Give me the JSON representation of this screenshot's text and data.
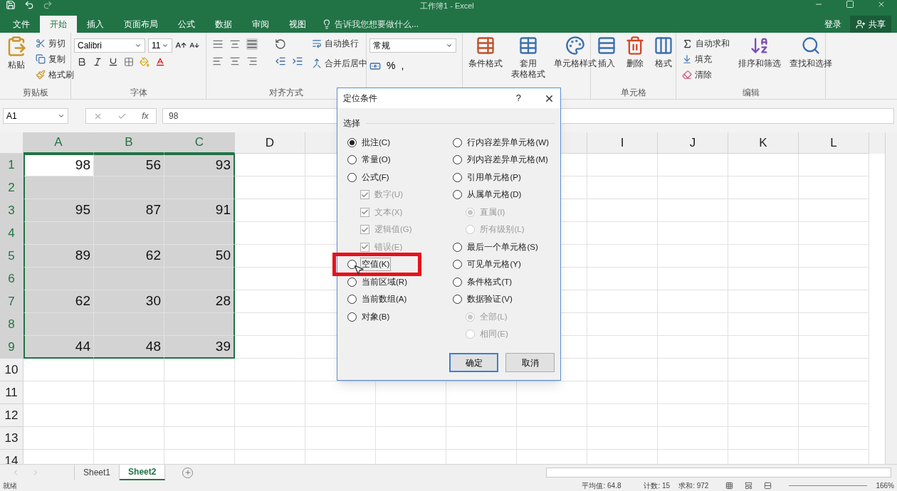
{
  "title_bar": {
    "title": "工作簿1 - Excel"
  },
  "tabs": [
    {
      "label": "文件",
      "selected": false
    },
    {
      "label": "开始",
      "selected": true
    },
    {
      "label": "插入",
      "selected": false
    },
    {
      "label": "页面布局",
      "selected": false
    },
    {
      "label": "公式",
      "selected": false
    },
    {
      "label": "数据",
      "selected": false
    },
    {
      "label": "审阅",
      "selected": false
    },
    {
      "label": "视图",
      "selected": false
    }
  ],
  "tell_me": {
    "placeholder": "告诉我您想要做什么..."
  },
  "account": {
    "sign_in": "登录",
    "share": "共享"
  },
  "ribbon": {
    "groups": [
      {
        "kind": "clipboard",
        "label": "剪贴板",
        "items": [
          "粘贴",
          "剪切",
          "复制",
          "格式刷"
        ]
      },
      {
        "kind": "font",
        "label": "字体",
        "font": "Calibri",
        "size": "11"
      },
      {
        "kind": "alignment",
        "label": "对齐方式",
        "items": [
          "自动换行",
          "合并后居中"
        ]
      },
      {
        "kind": "number",
        "format": "常规",
        "symbols": [
          "%",
          ","
        ]
      },
      {
        "kind": "styles",
        "items": [
          "条件格式",
          [
            "套用",
            "表格格式"
          ],
          "单元格样式"
        ]
      },
      {
        "kind": "cells",
        "label": "单元格",
        "items": [
          "插入",
          "删除",
          "格式"
        ]
      },
      {
        "kind": "editing",
        "label": "编辑",
        "items": [
          "自动求和",
          "填充",
          "清除",
          "排序和筛选",
          "查找和选择"
        ]
      }
    ]
  },
  "formula_bar": {
    "name_box": "A1",
    "function_label": "fx",
    "value": "98"
  },
  "sheet": {
    "columns_left": [
      "A",
      "B",
      "C",
      "D"
    ],
    "columns_right": [
      "I",
      "J",
      "K",
      "L"
    ],
    "rows": [
      {
        "label": "1",
        "cells": [
          {
            "value": "98",
            "in_range": true,
            "active": true
          },
          {
            "value": "56",
            "in_range": true,
            "active": false
          },
          {
            "value": "93",
            "in_range": true,
            "active": false
          }
        ]
      },
      {
        "label": "2",
        "cells": [
          {
            "in_range": true,
            "active": false
          },
          {
            "in_range": true,
            "active": false
          },
          {
            "in_range": true,
            "active": false
          }
        ]
      },
      {
        "label": "3",
        "cells": [
          {
            "value": "95",
            "in_range": true,
            "active": false
          },
          {
            "value": "87",
            "in_range": true,
            "active": false
          },
          {
            "value": "91",
            "in_range": true,
            "active": false
          }
        ]
      },
      {
        "label": "4",
        "cells": [
          {
            "in_range": true,
            "active": false
          },
          {
            "in_range": true,
            "active": false
          },
          {
            "in_range": true,
            "active": false
          }
        ]
      },
      {
        "label": "5",
        "cells": [
          {
            "value": "89",
            "in_range": true,
            "active": false
          },
          {
            "value": "62",
            "in_range": true,
            "active": false
          },
          {
            "value": "50",
            "in_range": true,
            "active": false
          }
        ]
      },
      {
        "label": "6",
        "cells": [
          {
            "in_range": true,
            "active": false
          },
          {
            "in_range": true,
            "active": false
          },
          {
            "in_range": true,
            "active": false
          }
        ]
      },
      {
        "label": "7",
        "cells": [
          {
            "value": "62",
            "in_range": true,
            "active": false
          },
          {
            "value": "30",
            "in_range": true,
            "active": false
          },
          {
            "value": "28",
            "in_range": true,
            "active": false
          }
        ]
      },
      {
        "label": "8",
        "cells": [
          {
            "in_range": true,
            "active": false
          },
          {
            "in_range": true,
            "active": false
          },
          {
            "in_range": true,
            "active": false
          }
        ]
      },
      {
        "label": "9",
        "cells": [
          {
            "value": "44",
            "in_range": true,
            "active": false
          },
          {
            "value": "48",
            "in_range": true,
            "active": false
          },
          {
            "value": "39",
            "in_range": true,
            "active": false
          }
        ]
      },
      {
        "label": "10",
        "cells": []
      },
      {
        "label": "11",
        "cells": []
      },
      {
        "label": "12",
        "cells": []
      },
      {
        "label": "13",
        "cells": []
      },
      {
        "label": "14",
        "cells": []
      }
    ]
  },
  "sheet_tabs": [
    {
      "label": "Sheet1",
      "selected": false
    },
    {
      "label": "Sheet2",
      "selected": true
    }
  ],
  "status_bar": {
    "state": "就绪",
    "average": "平均值: 64.8",
    "count": "计数: 15",
    "sum": "求和: 972",
    "zoom": "166%"
  },
  "dialog": {
    "title": "定位条件",
    "help": "?",
    "section": "选择",
    "left": [
      {
        "kind": "radio",
        "label": "批注(C)",
        "selected": true,
        "focused": false
      },
      {
        "kind": "radio",
        "label": "常量(O)",
        "selected": false,
        "focused": false
      },
      {
        "kind": "radio",
        "label": "公式(F)",
        "selected": false,
        "focused": false,
        "children": [
          {
            "kind": "checkbox",
            "label": "数字(U)",
            "checked": true,
            "disabled": true
          },
          {
            "kind": "checkbox",
            "label": "文本(X)",
            "checked": true,
            "disabled": true
          },
          {
            "kind": "checkbox",
            "label": "逻辑值(G)",
            "checked": true,
            "disabled": true
          },
          {
            "kind": "checkbox",
            "label": "错误(E)",
            "checked": true,
            "disabled": true
          }
        ]
      },
      {
        "kind": "radio",
        "label": "空值(K)",
        "selected": false,
        "focused": true
      },
      {
        "kind": "radio",
        "label": "当前区域(R)",
        "selected": false,
        "focused": false
      },
      {
        "kind": "radio",
        "label": "当前数组(A)",
        "selected": false,
        "focused": false
      },
      {
        "kind": "radio",
        "label": "对象(B)",
        "selected": false,
        "focused": false
      }
    ],
    "right": [
      {
        "kind": "radio",
        "label": "行内容差异单元格(W)",
        "selected": false,
        "focused": false
      },
      {
        "kind": "radio",
        "label": "列内容差异单元格(M)",
        "selected": false,
        "focused": false
      },
      {
        "kind": "radio",
        "label": "引用单元格(P)",
        "selected": false,
        "focused": false
      },
      {
        "kind": "radio",
        "label": "从属单元格(D)",
        "selected": false,
        "focused": false,
        "children": [
          {
            "kind": "radio",
            "label": "直属(I)",
            "selected": true,
            "disabled": true
          },
          {
            "kind": "radio",
            "label": "所有级别(L)",
            "selected": false,
            "disabled": true
          }
        ]
      },
      {
        "kind": "radio",
        "label": "最后一个单元格(S)",
        "selected": false,
        "focused": false
      },
      {
        "kind": "radio",
        "label": "可见单元格(Y)",
        "selected": false,
        "focused": false
      },
      {
        "kind": "radio",
        "label": "条件格式(T)",
        "selected": false,
        "focused": false
      },
      {
        "kind": "radio",
        "label": "数据验证(V)",
        "selected": false,
        "focused": false,
        "children": [
          {
            "kind": "radio",
            "label": "全部(L)",
            "selected": true,
            "disabled": true
          },
          {
            "kind": "radio",
            "label": "相同(E)",
            "selected": false,
            "disabled": true
          }
        ]
      }
    ],
    "buttons": [
      {
        "label": "确定",
        "default": true
      },
      {
        "label": "取消",
        "default": false
      }
    ]
  }
}
